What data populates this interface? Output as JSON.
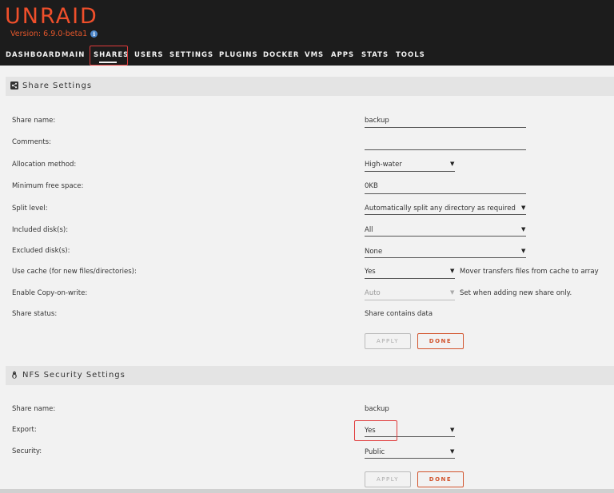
{
  "header": {
    "logo": "UNRAID",
    "version": "Version: 6.9.0-beta1",
    "info_icon": "i"
  },
  "nav": {
    "items": [
      "DASHBOARD",
      "MAIN",
      "SHARES",
      "USERS",
      "SETTINGS",
      "PLUGINS",
      "DOCKER",
      "VMS",
      "APPS",
      "STATS",
      "TOOLS"
    ],
    "active": "SHARES"
  },
  "share_settings": {
    "title": "Share Settings",
    "icon": "share-icon",
    "rows": {
      "share_name": {
        "label": "Share name:",
        "value": "backup"
      },
      "comments": {
        "label": "Comments:",
        "value": ""
      },
      "allocation": {
        "label": "Allocation method:",
        "value": "High-water"
      },
      "min_free": {
        "label": "Minimum free space:",
        "value": "0KB"
      },
      "split_level": {
        "label": "Split level:",
        "value": "Automatically split any directory as required"
      },
      "included": {
        "label": "Included disk(s):",
        "value": "All"
      },
      "excluded": {
        "label": "Excluded disk(s):",
        "value": "None"
      },
      "use_cache": {
        "label": "Use cache (for new files/directories):",
        "value": "Yes",
        "note": "Mover transfers files from cache to array"
      },
      "cow": {
        "label": "Enable Copy-on-write:",
        "value": "Auto",
        "note": "Set when adding new share only."
      },
      "status": {
        "label": "Share status:",
        "value": "Share contains data"
      }
    },
    "apply_label": "APPLY",
    "done_label": "DONE"
  },
  "nfs_settings": {
    "title": "NFS Security Settings",
    "icon": "linux-penguin-icon",
    "rows": {
      "share_name": {
        "label": "Share name:",
        "value": "backup"
      },
      "export": {
        "label": "Export:",
        "value": "Yes"
      },
      "security": {
        "label": "Security:",
        "value": "Public"
      }
    },
    "apply_label": "APPLY",
    "done_label": "DONE"
  },
  "colors": {
    "brand": "#ef4f2b",
    "highlight_box": "#e03b3b",
    "done_button": "#d2542d"
  }
}
